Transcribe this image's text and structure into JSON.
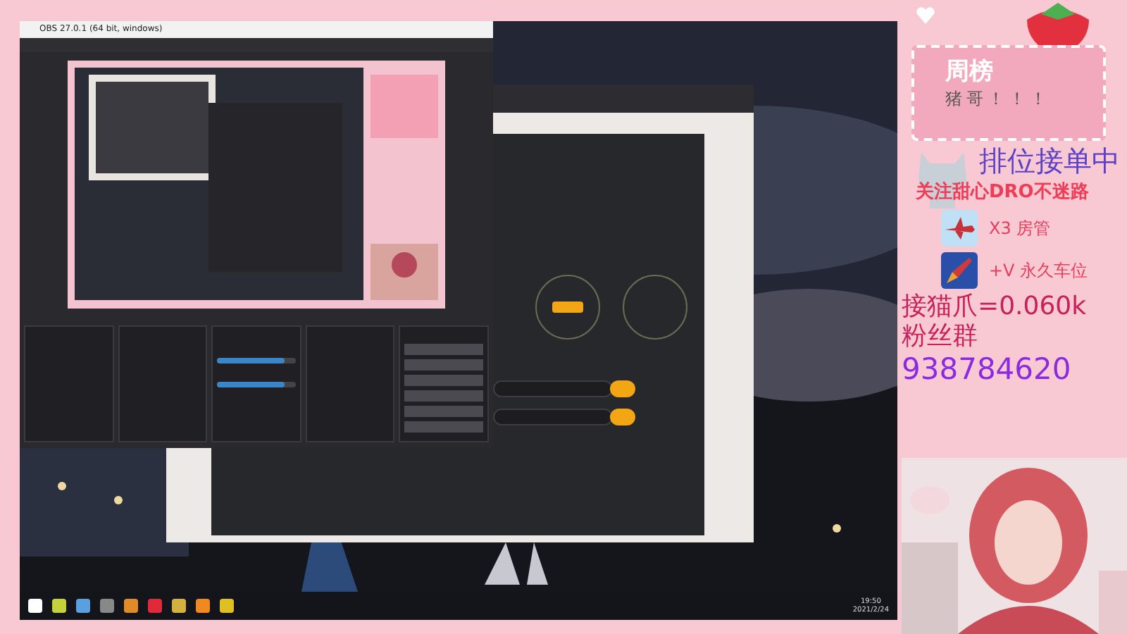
{
  "obs": {
    "title": "OBS 27.0.1 (64 bit, windows)",
    "mixer": [
      {
        "level": 0.86
      },
      {
        "level": 0.86
      }
    ]
  },
  "taskbar": {
    "time": "19:50",
    "date": "2021/2/24"
  },
  "overlay": {
    "rank_title": "周榜",
    "rank_entry": "猪哥！！！",
    "lines": [
      {
        "kind": "headline",
        "text": "排位接单中"
      },
      {
        "kind": "tagline",
        "text": "关注甜心DRO不迷路"
      },
      {
        "kind": "perk",
        "text": "X3 房管"
      },
      {
        "kind": "perk",
        "text": "+V 永久车位"
      },
      {
        "kind": "large",
        "text": "接猫爪=0.060k"
      },
      {
        "kind": "large",
        "text": "粉丝群"
      },
      {
        "kind": "number",
        "text": "938784620"
      }
    ]
  }
}
